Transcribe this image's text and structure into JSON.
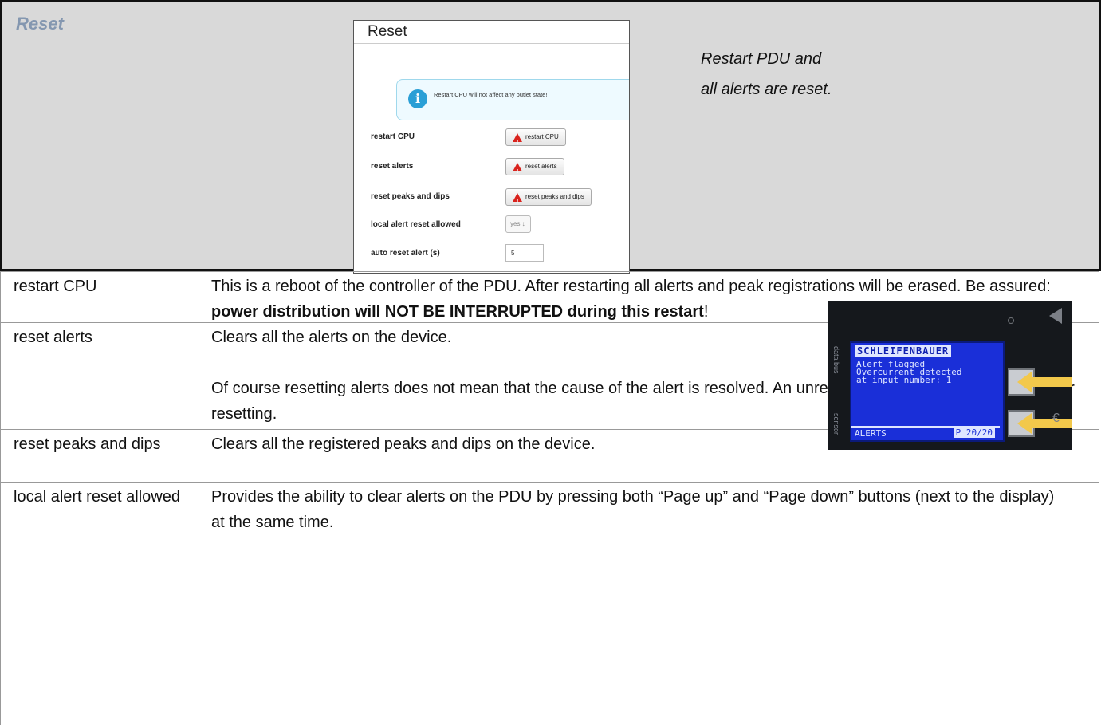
{
  "header": {
    "title": "Reset",
    "description_lines": [
      "Restart PDU and",
      "all alerts are reset."
    ]
  },
  "screenshot": {
    "title": "Reset",
    "info_text": "Restart CPU will not affect any outlet state!",
    "rows": [
      {
        "label": "restart CPU",
        "button": "restart CPU"
      },
      {
        "label": "reset alerts",
        "button": "reset alerts"
      },
      {
        "label": "reset peaks and dips",
        "button": "reset peaks and dips"
      }
    ],
    "local_alert_label": "local alert reset allowed",
    "local_alert_value": "yes ↕",
    "auto_reset_label": "auto reset alert (s)",
    "auto_reset_value": "5"
  },
  "table": [
    {
      "term": "restart CPU",
      "desc_a": "This is a reboot of the controller of the PDU. After restarting all alerts and peak registrations will be erased. Be assured: ",
      "desc_bold": "power distribution will NOT BE INTERRUPTED during this restart",
      "desc_b": "!"
    },
    {
      "term": "reset alerts",
      "desc_p1": "Clears all the alerts on the device.",
      "desc_p2": "Of course resetting alerts does not mean that the cause of the alert is resolved. An unresolved alert can occur directly after resetting."
    },
    {
      "term": "reset peaks and dips",
      "desc": "Clears all the registered peaks and dips on the device."
    },
    {
      "term": "local alert reset allowed",
      "desc": "Provides the ability to clear alerts on the PDU by pressing both “Page up” and “Page down” buttons (next to the display) at the same time."
    }
  ],
  "photo": {
    "brand": "SCHLEIFENBAUER",
    "lines": [
      "Alert flagged",
      "Overcurrent detected",
      "at input number: 1"
    ],
    "footer_left": "ALERTS",
    "footer_right": "P 20/20",
    "side_top": "data bus",
    "side_bottom": "sensor"
  }
}
